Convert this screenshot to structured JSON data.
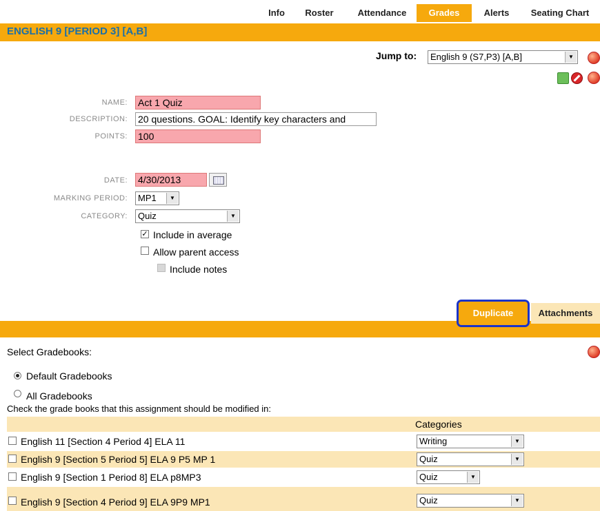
{
  "tabs": [
    "Info",
    "Roster",
    "Attendance",
    "Grades",
    "Alerts",
    "Seating Chart"
  ],
  "active_tab": "Grades",
  "page_title": "ENGLISH 9 [PERIOD 3] [A,B]",
  "jump": {
    "label": "Jump to:",
    "value": "English 9 (S7,P3) [A,B]"
  },
  "form": {
    "name_label": "NAME:",
    "name_value": "Act 1 Quiz",
    "description_label": "DESCRIPTION:",
    "description_value": "20 questions. GOAL: Identify key characters and",
    "points_label": "POINTS:",
    "points_value": "100",
    "date_label": "DATE:",
    "date_value": "4/30/2013",
    "marking_period_label": "MARKING PERIOD:",
    "marking_period_value": "MP1",
    "category_label": "CATEGORY:",
    "category_value": "Quiz",
    "include_average": "Include in average",
    "allow_parent": "Allow parent access",
    "include_notes": "Include notes"
  },
  "buttons": {
    "duplicate": "Duplicate",
    "attachments": "Attachments"
  },
  "gradebooks": {
    "select_label": "Select Gradebooks:",
    "default_label": "Default Gradebooks",
    "all_label": "All Gradebooks",
    "instructions": "Check the grade books that this assignment should be modified in:",
    "categories_header": "Categories",
    "rows": [
      {
        "name": "English 11 [Section 4 Period 4] ELA 11",
        "category": "Writing"
      },
      {
        "name": "English 9 [Section 5 Period 5] ELA 9 P5 MP 1",
        "category": "Quiz"
      },
      {
        "name": "English 9 [Section 1 Period 8] ELA p8MP3",
        "category": "Quiz"
      },
      {
        "name": "English 9 [Section 4 Period 9] ELA 9P9 MP1",
        "category": "Quiz"
      }
    ]
  },
  "icons": [
    "info-icon",
    "save-icon",
    "delete-icon"
  ],
  "colors": {
    "accent": "#f6a90d",
    "title": "#1a6fa8",
    "required": "#f8a7ad",
    "highlight_border": "#1a33c8"
  }
}
